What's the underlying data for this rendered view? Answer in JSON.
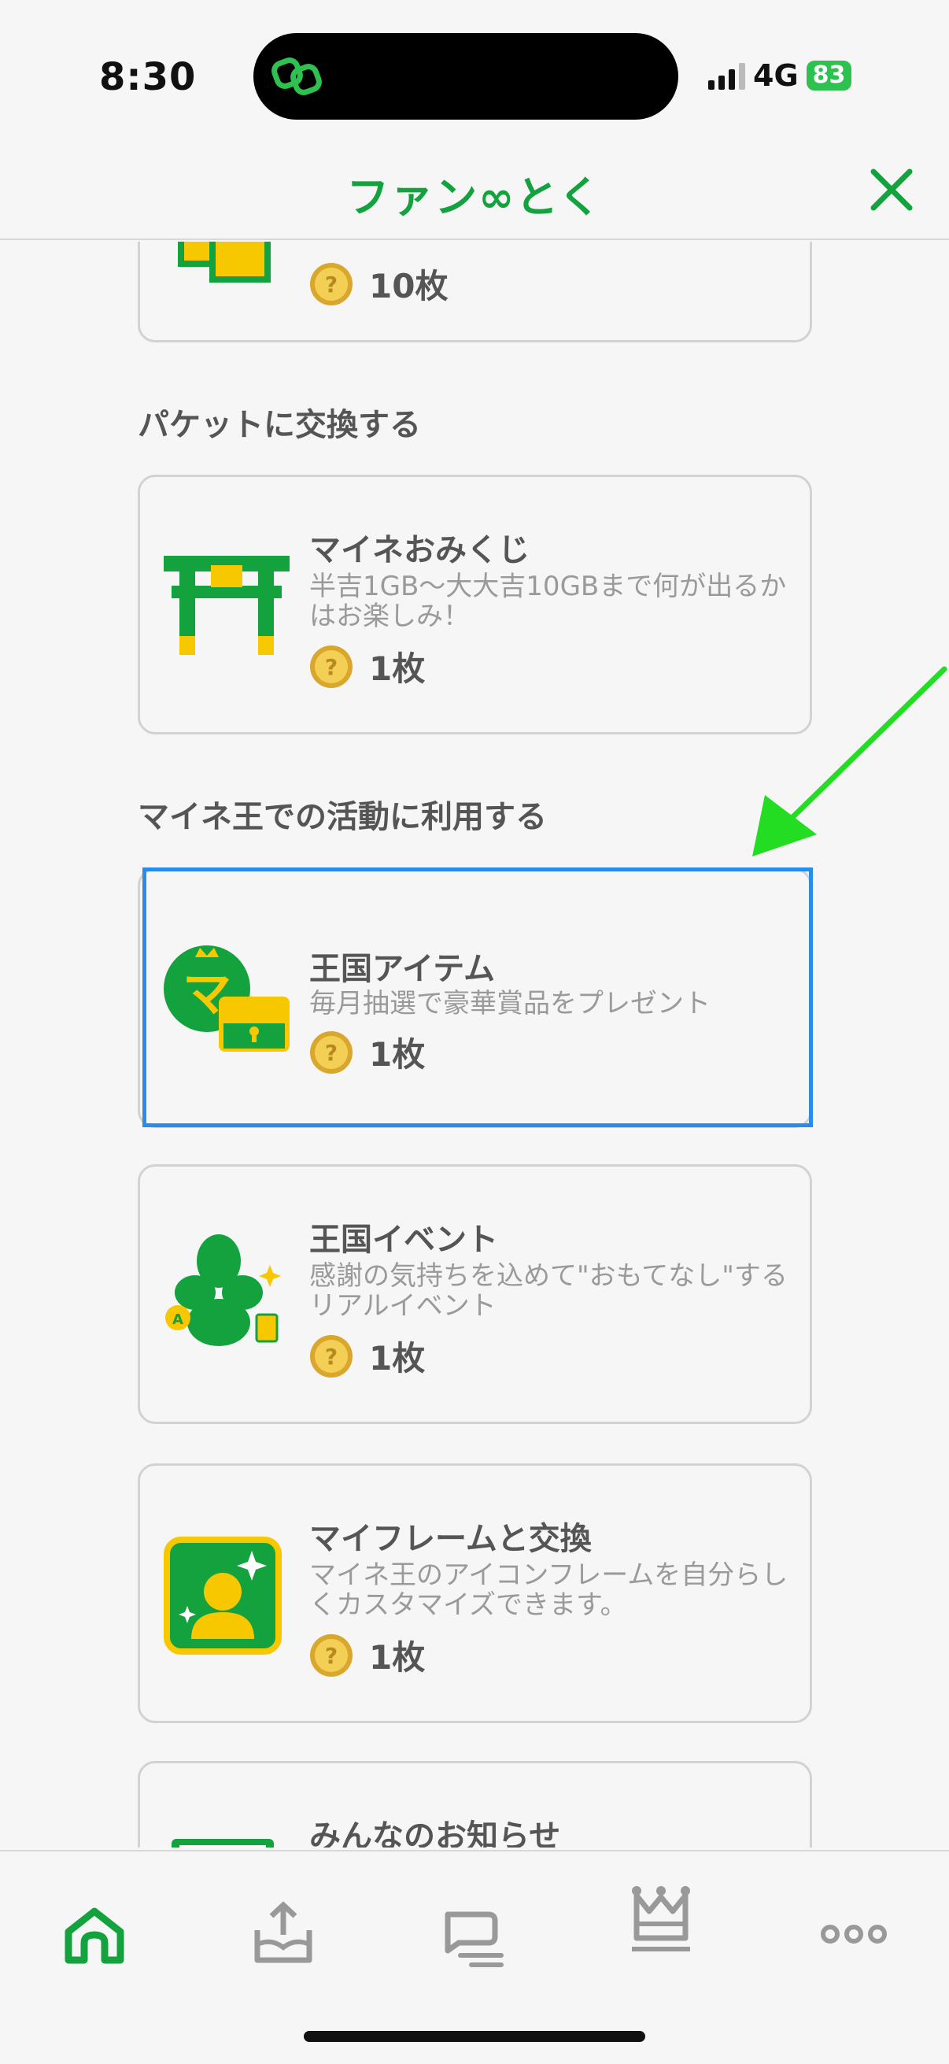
{
  "status_bar": {
    "time": "8:30",
    "network": "4G",
    "battery": "83"
  },
  "header": {
    "title": "ファン∞とく",
    "close_icon": "close-icon"
  },
  "colors": {
    "brand_green": "#13a23e",
    "accent_yellow": "#f7c800",
    "highlight_blue": "#2b8be8",
    "arrow_green": "#22dd22"
  },
  "cards": {
    "top_partial": {
      "coin_count": "10枚"
    },
    "omikuji": {
      "title": "マイネおみくじ",
      "desc": "半吉1GB〜大大吉10GBまで何が出るかはお楽しみ！",
      "coin_count": "1枚"
    },
    "item": {
      "title": "王国アイテム",
      "desc": "毎月抽選で豪華賞品をプレゼント",
      "coin_count": "1枚"
    },
    "event": {
      "title": "王国イベント",
      "desc": "感謝の気持ちを込めて\"おもてなし\"するリアルイベント",
      "coin_count": "1枚"
    },
    "frame": {
      "title": "マイフレームと交換",
      "desc": "マイネ王のアイコンフレームを自分らしくカスタマイズできます。",
      "coin_count": "1枚"
    },
    "news": {
      "title": "みんなのお知らせ"
    }
  },
  "sections": {
    "packet": "パケットに交換する",
    "activity": "マイネ王での活動に利用する"
  },
  "bottom_nav": {
    "items": [
      "home-icon",
      "inbox-upload-icon",
      "chat-icon",
      "crown-icon",
      "more-icon"
    ]
  }
}
